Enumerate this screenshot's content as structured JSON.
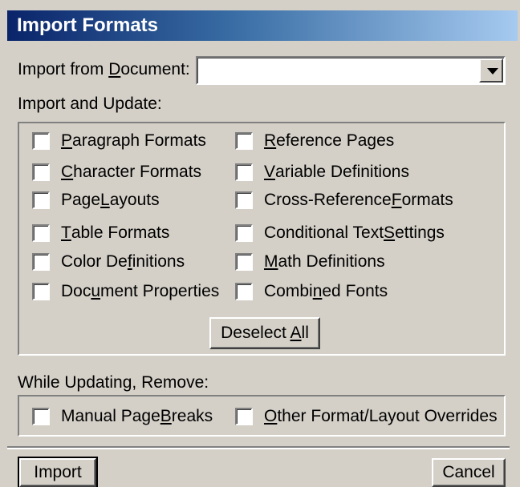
{
  "window": {
    "title": "Import Formats"
  },
  "import_from": {
    "label_pre": "Import from ",
    "label_key": "D",
    "label_post": "ocument:",
    "value": ""
  },
  "import_update": {
    "heading": "Import and Update:",
    "left": [
      {
        "pre": "",
        "key": "P",
        "post": "aragraph Formats",
        "checked": false
      },
      {
        "pre": "",
        "key": "C",
        "post": "haracter Formats",
        "checked": false
      },
      {
        "pre": "Page ",
        "key": "L",
        "post": "ayouts",
        "checked": false
      },
      {
        "pre": "",
        "key": "T",
        "post": "able Formats",
        "checked": false
      },
      {
        "pre": "Color De",
        "key": "f",
        "post": "initions",
        "checked": false
      },
      {
        "pre": "Doc",
        "key": "u",
        "post": "ment Properties",
        "checked": false
      }
    ],
    "right": [
      {
        "pre": "",
        "key": "R",
        "post": "eference Pages",
        "checked": false
      },
      {
        "pre": "",
        "key": "V",
        "post": "ariable Definitions",
        "checked": false
      },
      {
        "pre": "Cross-Reference ",
        "key": "F",
        "post": "ormats",
        "checked": false
      },
      {
        "pre": "Conditional Text ",
        "key": "S",
        "post": "ettings",
        "checked": false
      },
      {
        "pre": "",
        "key": "M",
        "post": "ath Definitions",
        "checked": false
      },
      {
        "pre": "Combi",
        "key": "n",
        "post": "ed Fonts",
        "checked": false
      }
    ],
    "deselect": {
      "pre": "Deselect ",
      "key": "A",
      "post": "ll"
    }
  },
  "while_updating": {
    "heading": "While Updating, Remove:",
    "items": [
      {
        "pre": "Manual Page ",
        "key": "B",
        "post": "reaks",
        "checked": false
      },
      {
        "pre": "",
        "key": "O",
        "post": "ther Format/Layout Overrides",
        "checked": false
      }
    ]
  },
  "buttons": {
    "import": "Import",
    "cancel": "Cancel"
  }
}
